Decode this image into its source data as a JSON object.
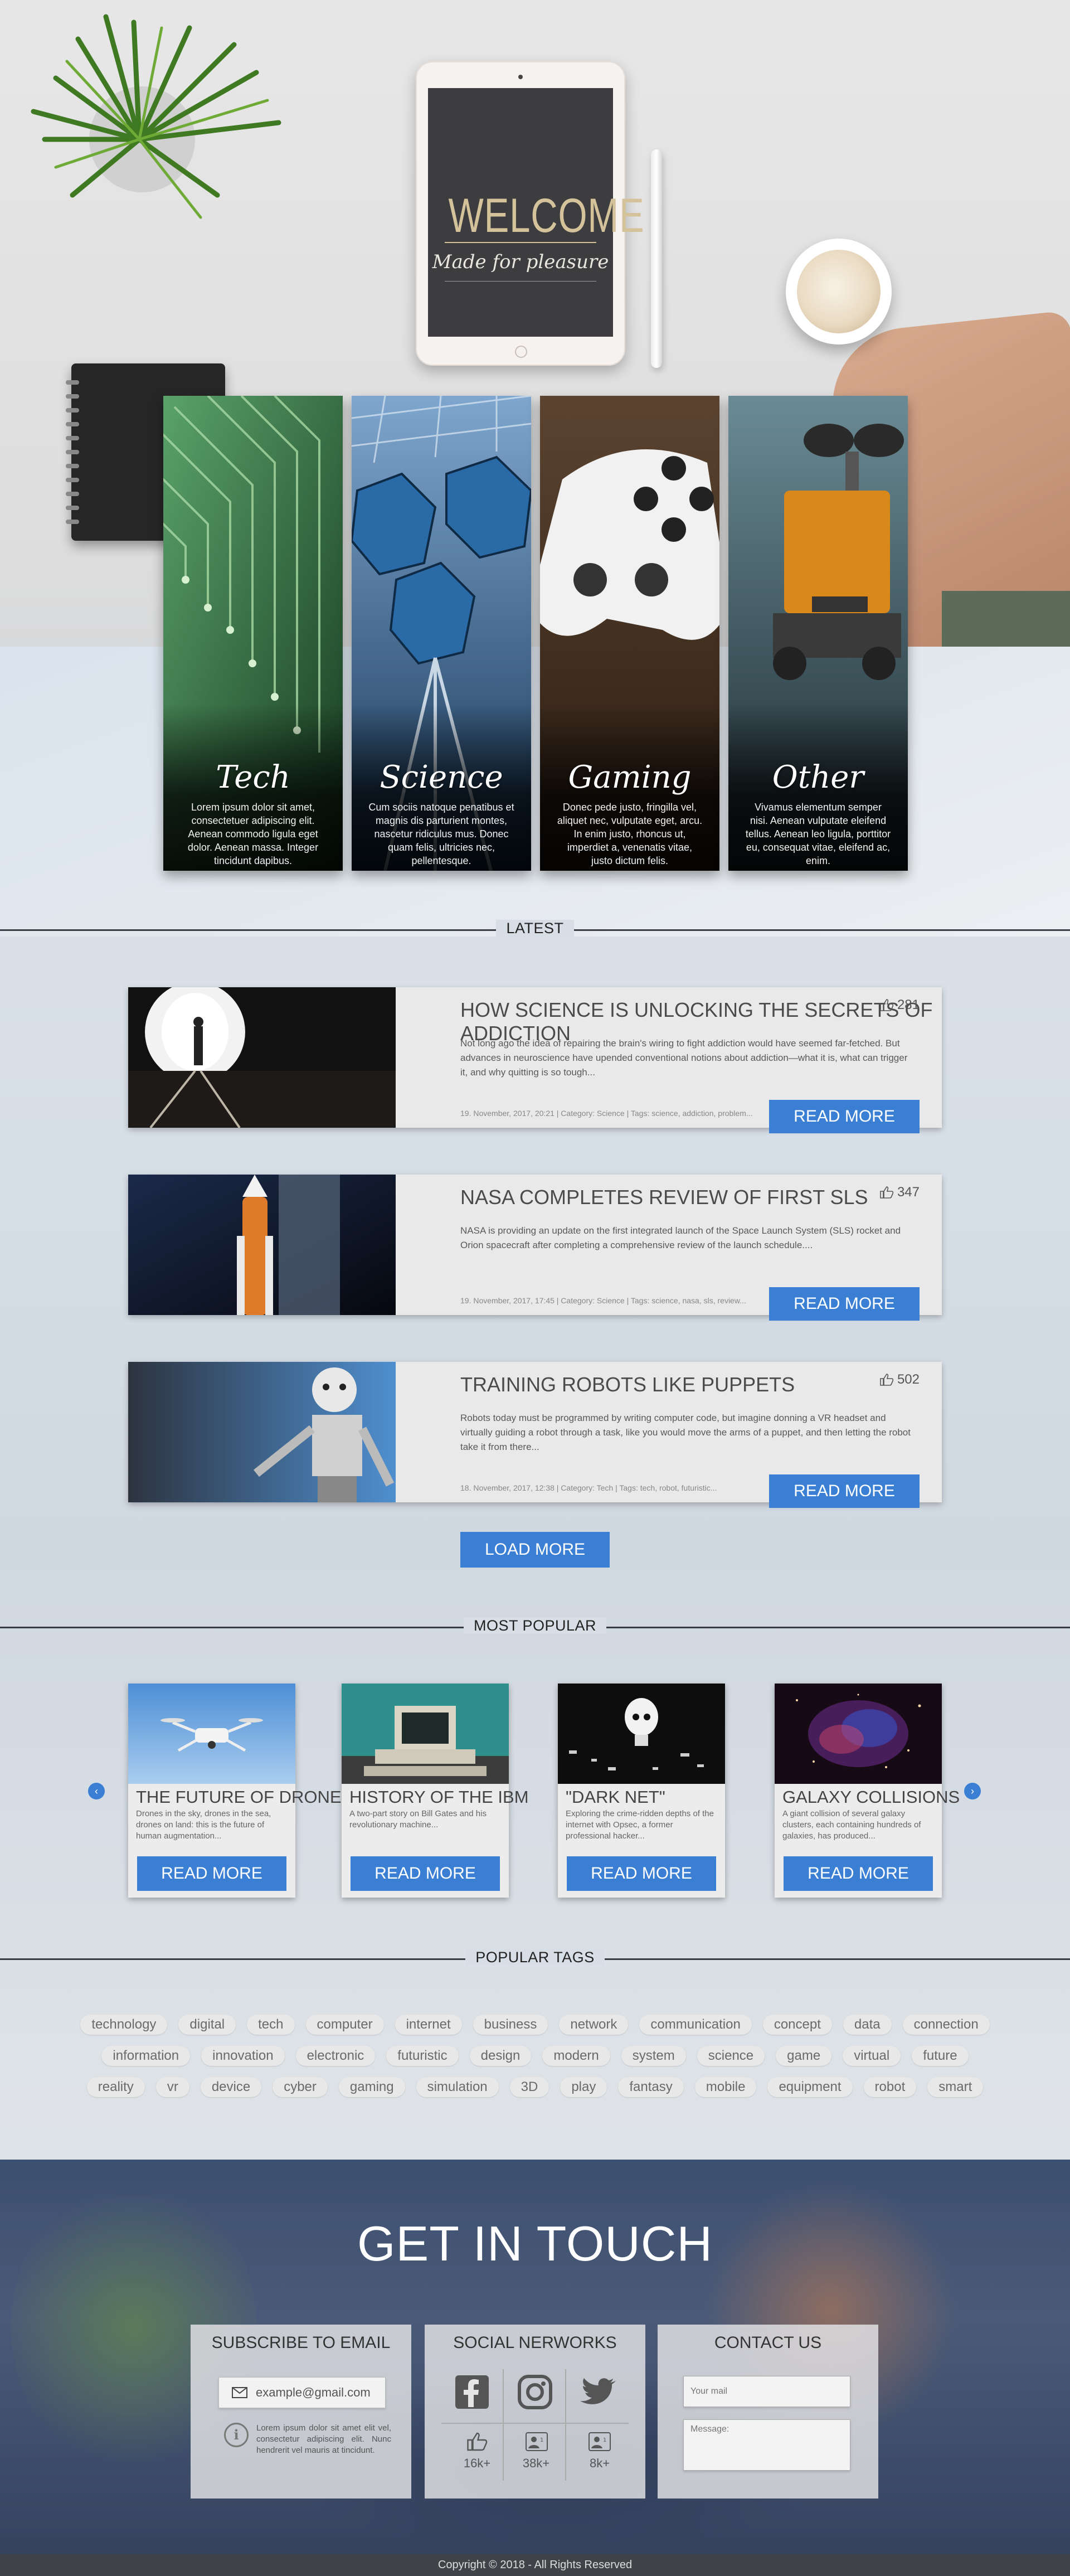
{
  "hero": {
    "tablet_title": "WELCOME",
    "tablet_subtitle": "Made for pleasure",
    "categories": [
      {
        "title": "Tech",
        "text": "Lorem ipsum dolor sit amet, consectetuer adipiscing elit. Aenean commodo ligula eget dolor. Aenean massa. Integer tincidunt dapibus."
      },
      {
        "title": "Science",
        "text": "Cum sociis natoque penatibus et magnis dis parturient montes, nascetur ridiculus mus. Donec quam felis, ultricies nec, pellentesque."
      },
      {
        "title": "Gaming",
        "text": "Donec pede justo, fringilla vel, aliquet nec, vulputate eget, arcu. In enim justo, rhoncus ut, imperdiet a, venenatis vitae, justo dictum felis."
      },
      {
        "title": "Other",
        "text": "Vivamus elementum semper nisi. Aenean vulputate eleifend tellus. Aenean leo ligula, porttitor eu, consequat vitae, eleifend ac, enim."
      }
    ]
  },
  "latest": {
    "heading": "LATEST",
    "articles": [
      {
        "title": "HOW SCIENCE IS UNLOCKING THE SECRETS OF ADDICTION",
        "likes": "281",
        "body": "Not long ago the idea of repairing the brain's wiring to fight addiction would have seemed far-fetched. But advances in neuroscience have upended conventional notions about addiction—what it is, what can trigger it, and why quitting is so tough...",
        "meta": "19. November, 2017, 20:21 | Category: Science | Tags: science, addiction, problem...",
        "button": "READ MORE"
      },
      {
        "title": "NASA COMPLETES REVIEW OF FIRST SLS",
        "likes": "347",
        "body": "NASA is providing an update on the first integrated launch of the Space Launch System (SLS) rocket and Orion spacecraft after completing a comprehensive review of the launch schedule....",
        "meta": "19. November, 2017, 17:45 | Category: Science | Tags: science, nasa, sls, review...",
        "button": "READ MORE"
      },
      {
        "title": "TRAINING ROBOTS LIKE PUPPETS",
        "likes": "502",
        "body": "Robots today must be programmed by writing computer code, but imagine donning a VR headset and virtually guiding a robot through a task, like you would move the arms of a puppet, and then letting the robot take it from there...",
        "meta": "18. November, 2017, 12:38 | Category: Tech | Tags: tech, robot, futuristic...",
        "button": "READ MORE"
      }
    ],
    "load_more": "LOAD MORE"
  },
  "popular": {
    "heading": "MOST POPULAR",
    "prev": "‹",
    "next": "›",
    "items": [
      {
        "title": "THE FUTURE OF DRONES",
        "text": "Drones in the sky, drones in the sea, drones on land: this is the future of human augmentation...",
        "button": "READ MORE"
      },
      {
        "title": "HISTORY OF THE IBM",
        "text": "A two-part story on Bill Gates and his revolutionary machine...",
        "button": "READ MORE"
      },
      {
        "title": "\"DARK NET\"",
        "text": "Exploring the crime-ridden depths of the internet with Opsec, a former professional hacker...",
        "button": "READ MORE"
      },
      {
        "title": "GALAXY COLLISIONS",
        "text": "A giant collision of several galaxy clusters, each containing hundreds of galaxies, has produced...",
        "button": "READ MORE"
      }
    ]
  },
  "tags": {
    "heading": "POPULAR TAGS",
    "rows": [
      [
        "technology",
        "digital",
        "tech",
        "computer",
        "internet",
        "business",
        "network",
        "communication",
        "concept",
        "data",
        "connection"
      ],
      [
        "information",
        "innovation",
        "electronic",
        "futuristic",
        "design",
        "modern",
        "system",
        "science",
        "game",
        "virtual",
        "future"
      ],
      [
        "reality",
        "vr",
        "device",
        "cyber",
        "gaming",
        "simulation",
        "3D",
        "play",
        "fantasy",
        "mobile",
        "equipment",
        "robot",
        "smart"
      ]
    ]
  },
  "contact": {
    "title": "GET IN TOUCH",
    "subscribe": {
      "title": "SUBSCRIBE TO EMAIL",
      "email_placeholder": "example@gmail.com",
      "info": "Lorem ipsum dolor sit amet elit vel, consectetur adipiscing elit. Nunc hendrerit vel mauris at tincidunt."
    },
    "social": {
      "title": "SOCIAL NERWORKS",
      "counts": [
        "16k+",
        "38k+",
        "8k+"
      ]
    },
    "form": {
      "title": "CONTACT US",
      "mail_placeholder": "Your mail",
      "message_placeholder": "Message:"
    }
  },
  "footer": {
    "copyright": "Copyright © 2018 - All Rights Reserved"
  },
  "colors": {
    "accent": "#3a7fd4",
    "dark_line": "#3a3e44",
    "footer_bg": "#404347"
  }
}
